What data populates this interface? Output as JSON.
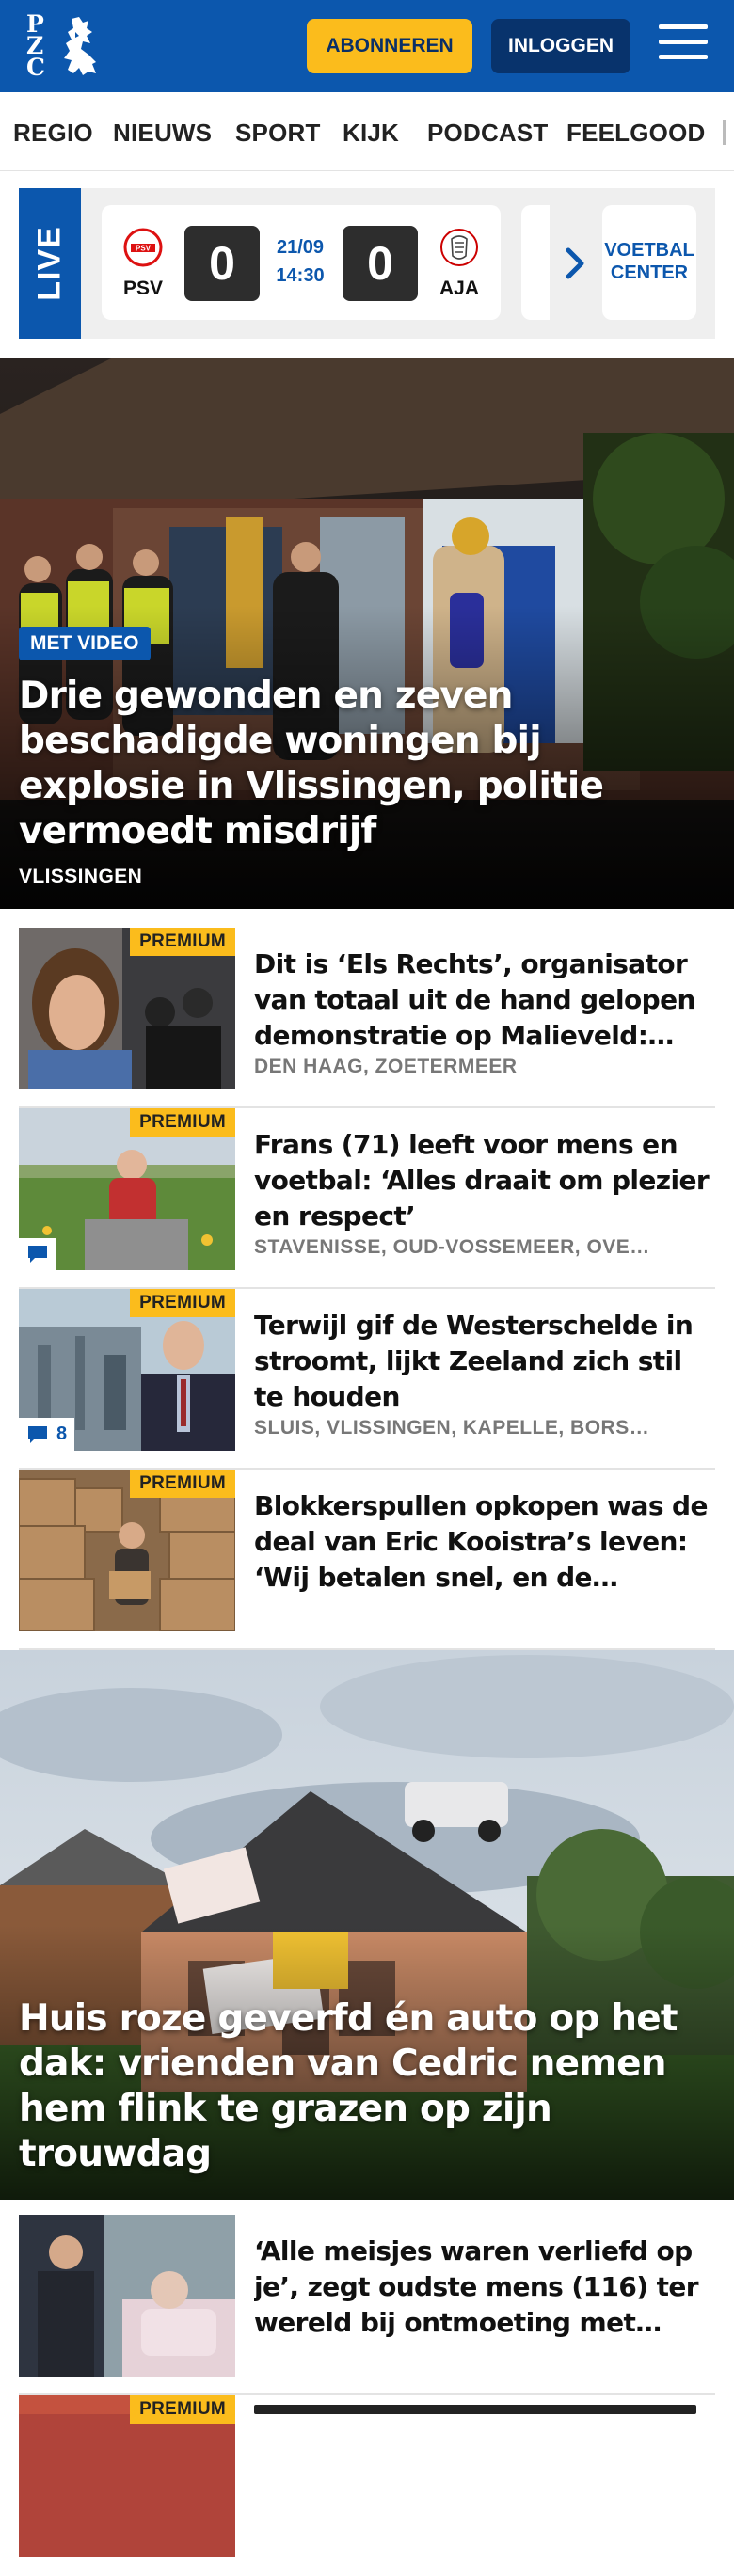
{
  "brand": {
    "logo_text": "PZC",
    "accent": "#0c57ad",
    "subscribe_color": "#fbbc1c"
  },
  "header": {
    "subscribe_label": "ABONNEREN",
    "login_label": "INLOGGEN",
    "menu_icon": "hamburger-icon"
  },
  "nav": {
    "items": [
      "REGIO",
      "NIEUWS",
      "SPORT",
      "KIJK",
      "PODCAST",
      "FEELGOOD"
    ]
  },
  "live": {
    "label": "LIVE",
    "match": {
      "home": "PSV",
      "away": "AJA",
      "home_score": "0",
      "away_score": "0",
      "date": "21/09",
      "time": "14:30"
    },
    "center_label_1": "VOETBAL",
    "center_label_2": "CENTER"
  },
  "hero": {
    "badge": "MET VIDEO",
    "title": "Drie gewonden en zeven beschadigde woningen bij explosie in Vlissingen, politie vermoedt misdrijf",
    "location": "VLISSINGEN"
  },
  "articles": [
    {
      "premium": "PREMIUM",
      "title": "Dit is ‘Els Rechts’, organisator van totaal uit de hand gelopen demonstratie op Malieveld: ‘Ik…",
      "location": "DEN HAAG, ZOETERMEER",
      "comments": ""
    },
    {
      "premium": "PREMIUM",
      "title": "Frans (71) leeft voor mens en voetbal: ‘Alles draait om plezier en respect’",
      "location": "STAVENISSE, OUD-VOSSEMEER, OVE…",
      "comments": ""
    },
    {
      "premium": "PREMIUM",
      "title": "Terwijl gif de Westerschelde in stroomt, lijkt Zeeland zich stil te houden",
      "location": "SLUIS, VLISSINGEN, KAPELLE, BORS…",
      "comments": "8"
    },
    {
      "premium": "PREMIUM",
      "title": "Blokkerspullen opkopen was de deal van Eric Kooistra’s leven: ‘Wij betalen snel, en de Chineze…",
      "location": "",
      "comments": ""
    }
  ],
  "hero2": {
    "title": "Huis roze geverfd én auto op het dak: vrienden van Cedric nemen hem flink te grazen op zijn trouwdag"
  },
  "articles2": [
    {
      "title": "‘Alle meisjes waren verliefd op je’, zegt oudste mens (116) ter wereld bij ontmoeting met…"
    },
    {
      "premium": "PREMIUM"
    }
  ]
}
